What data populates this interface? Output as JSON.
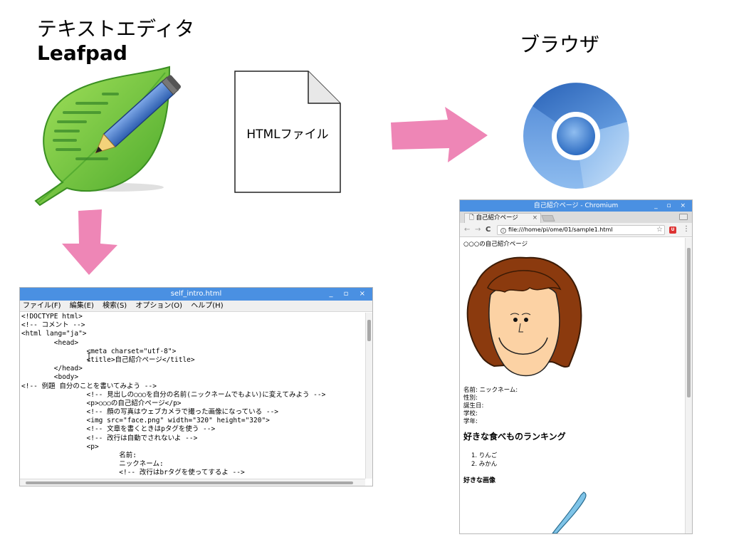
{
  "editor_label": {
    "jp": "テキストエディタ",
    "en": "Leafpad"
  },
  "browser_label": "ブラウザ",
  "file_label": "HTMLファイル",
  "colors": {
    "arrow": "#ee86b6",
    "titlebar": "#4a90e2",
    "leaf": "#6cc644"
  },
  "icons": {
    "leafpad": "leafpad-icon",
    "file": "file-icon",
    "chromium": "chromium-icon"
  },
  "leafpad": {
    "title": "self_intro.html",
    "controls": "_ ▫ ×",
    "menu": [
      "ファイル(F)",
      "編集(E)",
      "検索(S)",
      "オプション(O)",
      "ヘルプ(H)"
    ],
    "lines": [
      "<!DOCTYPE html>",
      "<!-- コメント -->",
      "<html lang=\"ja\">",
      "        <head>",
      "                <meta charset=\"utf-8\">",
      "                <title>自己紹介ページ</title>",
      "        </head>",
      "        <body>",
      "<!-- 例題 自分のことを書いてみよう -->",
      "                <!-- 見出しの○○○を自分の名前(ニックネームでもよい)に変えてみよう -->",
      "                <p>○○○の自己紹介ページ</p>",
      "                <!-- 顔の写真はウェブカメラで撮った画像になっている -->",
      "                <img src=\"face.png\" width=\"320\" height=\"320\">",
      "                <!-- 文章を書くときはpタグを使う -->",
      "                <!-- 改行は自動でされないよ -->",
      "                <p>",
      "                        名前:",
      "                        ニックネーム:",
      "                        <!-- 改行はbrタグを使ってするよ -->"
    ]
  },
  "chromium": {
    "title": "自己紹介ページ - Chromium",
    "controls": "_ ▫ ×",
    "tab_title": "自己紹介ページ",
    "tab_close": "×",
    "nav": {
      "back": "←",
      "forward": "→",
      "reload": "C"
    },
    "url": "file:///home/pi/ome/01/sample1.html",
    "star": "☆",
    "menu": "⋮",
    "page": {
      "heading_line": "○○○の自己紹介ページ",
      "fields": [
        "名前: ニックネーム:",
        "性別:",
        "誕生日:",
        "学校:",
        "学年:"
      ],
      "ranking_title": "好きな食べものランキング",
      "ranking_items": [
        "1. りんご",
        "2. みかん"
      ],
      "favorite_image_title": "好きな画像"
    }
  }
}
